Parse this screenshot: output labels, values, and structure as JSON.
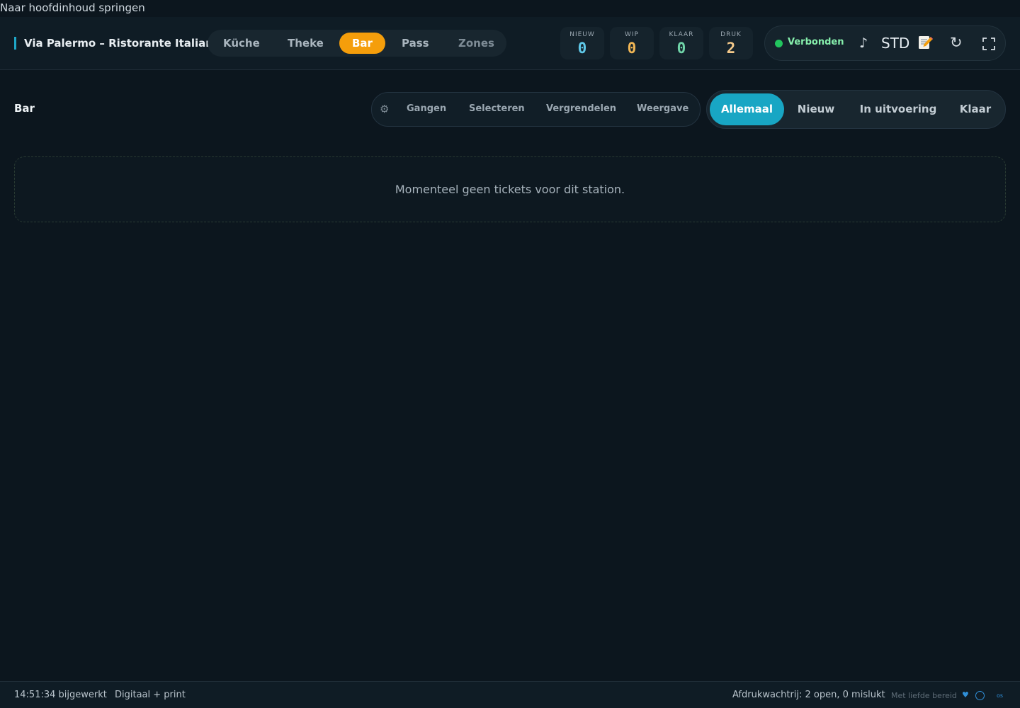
{
  "skip_link": "Naar hoofdinhoud springen",
  "header": {
    "brand": "Via Palermo – Ristorante Italiano",
    "station_tabs": [
      {
        "label": "Küche",
        "active": false
      },
      {
        "label": "Theke",
        "active": false
      },
      {
        "label": "Bar",
        "active": true
      },
      {
        "label": "Pass",
        "active": false
      },
      {
        "label": "Zones",
        "active": false
      }
    ],
    "counters": [
      {
        "label": "NIEUW",
        "value": "0"
      },
      {
        "label": "WIP",
        "value": "0"
      },
      {
        "label": "KLAAR",
        "value": "0"
      },
      {
        "label": "DRUK",
        "value": "2"
      }
    ],
    "status": {
      "connection": "Verbonden",
      "mode": "STD"
    }
  },
  "main": {
    "title": "Bar",
    "tools": [
      "Gangen",
      "Selecteren",
      "Vergrendelen",
      "Weergave"
    ],
    "filters": [
      {
        "label": "Allemaal",
        "active": true
      },
      {
        "label": "Nieuw",
        "active": false
      },
      {
        "label": "In uitvoering",
        "active": false
      },
      {
        "label": "Klaar",
        "active": false
      }
    ],
    "empty_message": "Momenteel geen tickets voor dit station."
  },
  "footer": {
    "updated": "14:51:34 bijgewerkt",
    "mode": "Digitaal + print",
    "queue": "Afdrukwachtrij: 2 open, 0 mislukt",
    "love": "Met liefde bereid",
    "os": "os"
  },
  "colors": {
    "accent": "#18a6c4",
    "active_station": "#f59e0b",
    "connected": "#22c55e",
    "background": "#0c161e"
  }
}
